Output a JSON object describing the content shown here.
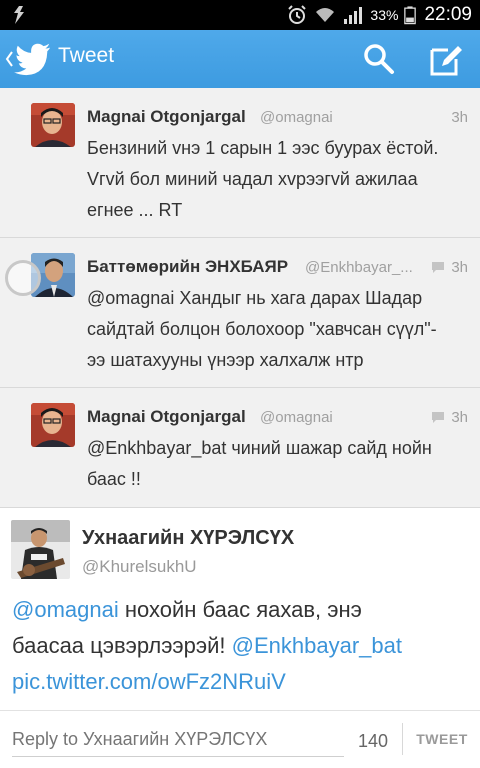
{
  "status_bar": {
    "battery_pct": "33%",
    "time": "22:09"
  },
  "action_bar": {
    "title": "Tweet",
    "colors": {
      "bar": "#4fa9ea"
    }
  },
  "feed": [
    {
      "name": "Magnai Otgonjargal",
      "handle": "@omagnai",
      "time": "3h",
      "has_reply_icon": false,
      "lines": [
        "Бензиний vнэ 1 сарын 1 ээс буурах ёстой.",
        "Vгvй бол миний чадал хvрээгvй ажилаа",
        "егнее ... RT"
      ]
    },
    {
      "name": "Баттөмөрийн ЭНХБАЯР",
      "handle": "@Enkhbayar_...",
      "time": "3h",
      "has_reply_icon": true,
      "lines": [
        "@omagnai Хандыг нь хага дарах Шадар",
        "сайдтай болцон болохоор \"хавчсан сүүл\"-",
        "ээ шатахууны үнээр халхалж нтр"
      ]
    },
    {
      "name": "Magnai Otgonjargal",
      "handle": "@omagnai",
      "time": "3h",
      "has_reply_icon": true,
      "lines": [
        "@Enkhbayar_bat чиний шажар сайд нойн",
        "баас !!"
      ]
    }
  ],
  "focus": {
    "name": "Ухнаагийн ХҮРЭЛСҮХ",
    "handle": "@KhurelsukhU",
    "mention1": "@omagnai",
    "text1": " нохойн баас яахав, энэ",
    "text2": "баасаа цэвэрлээрэй! ",
    "mention2": "@Enkhbayar_bat",
    "link": "pic.twitter.com/owFz2NRuiV"
  },
  "reply_bar": {
    "placeholder": "Reply to Ухнаагийн ХҮРЭЛСҮХ",
    "count": "140",
    "tweet_label": "TWEET"
  },
  "colors": {
    "link": "#3b94d9",
    "accent": "#55acee"
  },
  "icons": [
    "usb-debug-icon",
    "alarm-icon",
    "wifi-icon",
    "signal-icon",
    "battery-icon",
    "back-chevron-icon",
    "twitter-bird-icon",
    "search-icon",
    "compose-icon",
    "reply-icon"
  ]
}
